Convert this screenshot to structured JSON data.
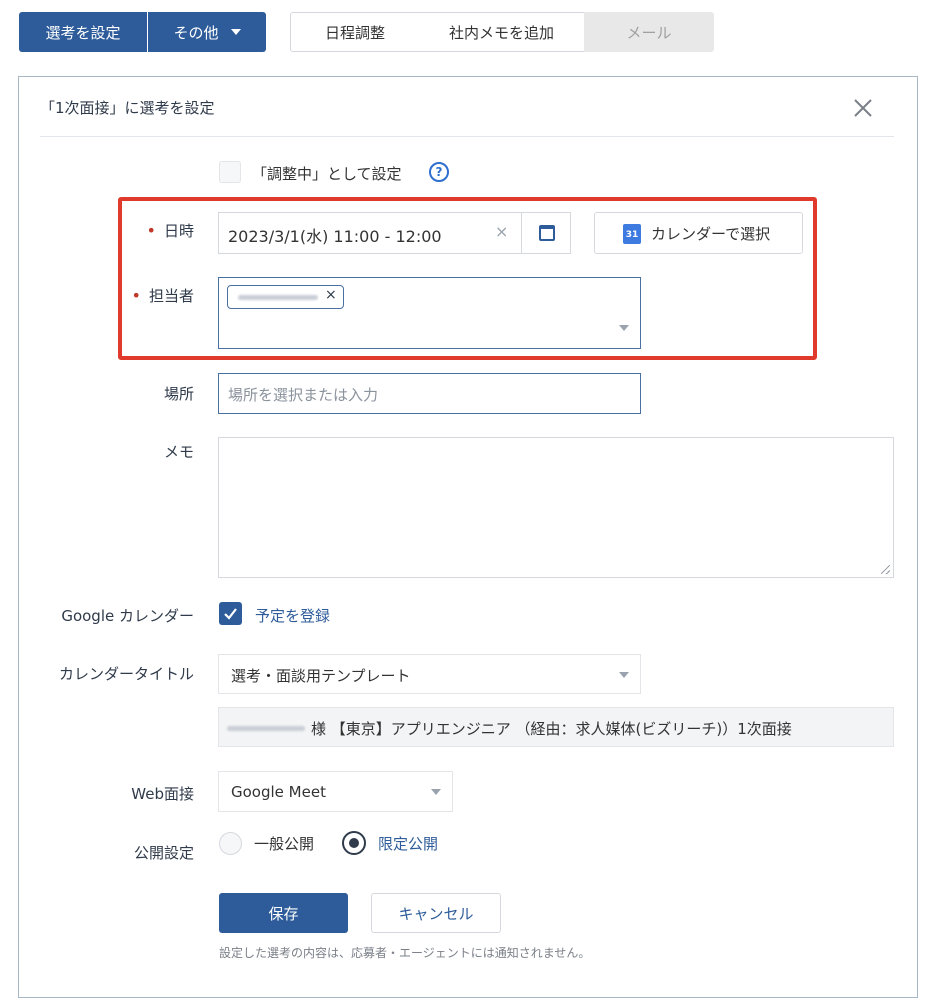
{
  "toolbar": {
    "set_selection_label": "選考を設定",
    "more_label": "その他",
    "schedule_tab": "日程調整",
    "memo_tab": "社内メモを追加",
    "mail_tab": "メール"
  },
  "dialog": {
    "title": "「1次面接」に選考を設定",
    "adjusting_label": "「調整中」として設定",
    "datetime_label": "日時",
    "datetime_value": "2023/3/1(水) 11:00 - 12:00",
    "calendar_select_label": "カレンダーで選択",
    "calendar_icon_day": "31",
    "assignee_label": "担当者",
    "location_label": "場所",
    "location_placeholder": "場所を選択または入力",
    "memo_label": "メモ",
    "google_calendar_label": "Google カレンダー",
    "register_event_label": "予定を登録",
    "calendar_title_label": "カレンダータイトル",
    "calendar_title_select": "選考・面談用テンプレート",
    "calendar_title_preview": "様 【東京】アプリエンジニア （経由：求人媒体(ビズリーチ)）1次面接",
    "web_interview_label": "Web面接",
    "web_interview_value": "Google Meet",
    "visibility_label": "公開設定",
    "visibility_options": [
      "一般公開",
      "限定公開"
    ],
    "visibility_selected": "限定公開",
    "save_label": "保存",
    "cancel_label": "キャンセル",
    "footnote": "設定した選考の内容は、応募者・エージェントには通知されません。"
  },
  "colors": {
    "primary": "#2e5c9a",
    "highlight": "#e03a2c",
    "required": "#c0392b"
  }
}
